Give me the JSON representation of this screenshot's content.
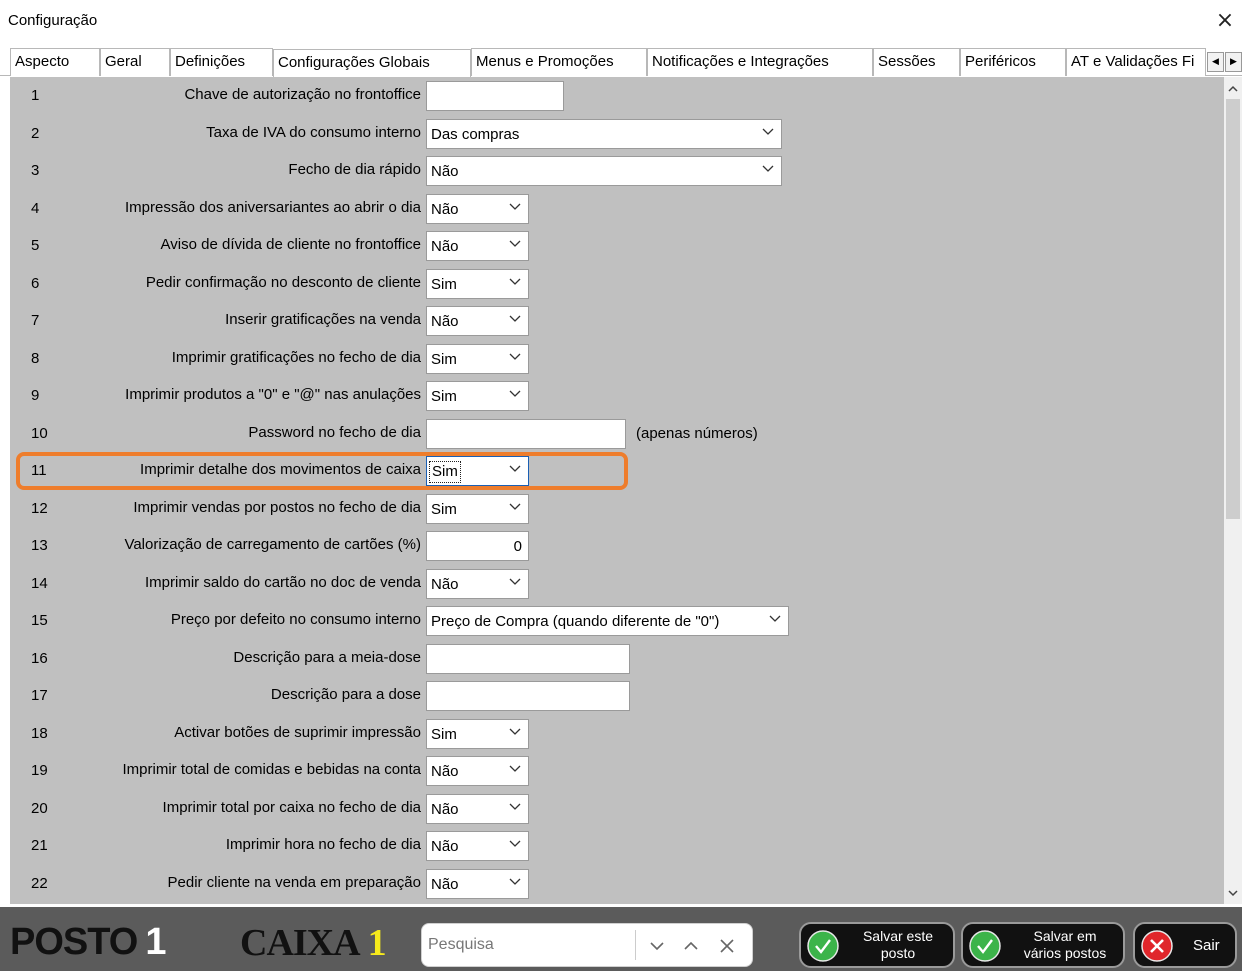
{
  "window": {
    "title": "Configuração",
    "close_glyph": "×"
  },
  "tabs": [
    {
      "label": "Aspecto"
    },
    {
      "label": "Geral"
    },
    {
      "label": "Definições"
    },
    {
      "label": "Configurações Globais",
      "active": true
    },
    {
      "label": "Menus e Promoções"
    },
    {
      "label": "Notificações e Integrações"
    },
    {
      "label": "Sessões"
    },
    {
      "label": "Periféricos"
    },
    {
      "label": "AT e Validações Fi"
    }
  ],
  "tab_scroll": {
    "left": "◀",
    "right": "▶"
  },
  "rows": [
    {
      "num": "1",
      "label": "Chave de autorização no frontoffice",
      "type": "input",
      "value": ""
    },
    {
      "num": "2",
      "label": "Taxa de IVA do consumo interno",
      "type": "select",
      "value": "Das compras"
    },
    {
      "num": "3",
      "label": "Fecho de dia rápido",
      "type": "select",
      "value": "Não"
    },
    {
      "num": "4",
      "label": "Impressão dos aniversariantes ao abrir o dia",
      "type": "select",
      "value": "Não"
    },
    {
      "num": "5",
      "label": "Aviso de dívida de cliente no frontoffice",
      "type": "select",
      "value": "Não"
    },
    {
      "num": "6",
      "label": "Pedir confirmação no desconto de cliente",
      "type": "select",
      "value": "Sim"
    },
    {
      "num": "7",
      "label": "Inserir gratificações na venda",
      "type": "select",
      "value": "Não"
    },
    {
      "num": "8",
      "label": "Imprimir gratificações no fecho de dia",
      "type": "select",
      "value": "Sim"
    },
    {
      "num": "9",
      "label": "Imprimir produtos a \"0\" e \"@\" nas anulações",
      "type": "select",
      "value": "Sim"
    },
    {
      "num": "10",
      "label": "Password no fecho de dia",
      "type": "input",
      "value": "",
      "hint": "(apenas números)"
    },
    {
      "num": "11",
      "label": "Imprimir detalhe dos movimentos de caixa",
      "type": "select",
      "value": "Sim",
      "focused": true
    },
    {
      "num": "12",
      "label": "Imprimir vendas por postos no fecho de dia",
      "type": "select",
      "value": "Sim"
    },
    {
      "num": "13",
      "label": "Valorização de carregamento de cartões (%)",
      "type": "input",
      "value": "0"
    },
    {
      "num": "14",
      "label": "Imprimir saldo do cartão no doc de venda",
      "type": "select",
      "value": "Não"
    },
    {
      "num": "15",
      "label": "Preço por defeito no consumo interno",
      "type": "select",
      "value": "Preço de Compra (quando diferente de \"0\")"
    },
    {
      "num": "16",
      "label": "Descrição para a meia-dose",
      "type": "input",
      "value": ""
    },
    {
      "num": "17",
      "label": "Descrição para a dose",
      "type": "input",
      "value": ""
    },
    {
      "num": "18",
      "label": "Activar botões de suprimir impressão",
      "type": "select",
      "value": "Sim"
    },
    {
      "num": "19",
      "label": "Imprimir total de comidas e bebidas na conta",
      "type": "select",
      "value": "Não"
    },
    {
      "num": "20",
      "label": "Imprimir total por caixa no fecho de dia",
      "type": "select",
      "value": "Não"
    },
    {
      "num": "21",
      "label": "Imprimir hora no fecho de dia",
      "type": "select",
      "value": "Não"
    },
    {
      "num": "22",
      "label": "Pedir cliente na venda em preparação",
      "type": "select",
      "value": "Não"
    }
  ],
  "bottom": {
    "posto_label": "POSTO",
    "posto_number": "1",
    "caixa_label": "CAIXA",
    "caixa_number": "1",
    "search_placeholder": "Pesquisa",
    "save_button": {
      "line1": "Salvar este",
      "line2": "posto"
    },
    "save_multi_button": {
      "line1": "Salvar em",
      "line2": "vários postos"
    },
    "exit_button": {
      "label": "Sair"
    }
  },
  "colors": {
    "grid_background": "#c0c0c0",
    "highlight_border": "#ee7d2c",
    "bottom_bar": "#5b5b5b",
    "caixa_number": "#f7ea1c",
    "ok_green": "#3cb44a",
    "exit_red": "#e0262b"
  }
}
